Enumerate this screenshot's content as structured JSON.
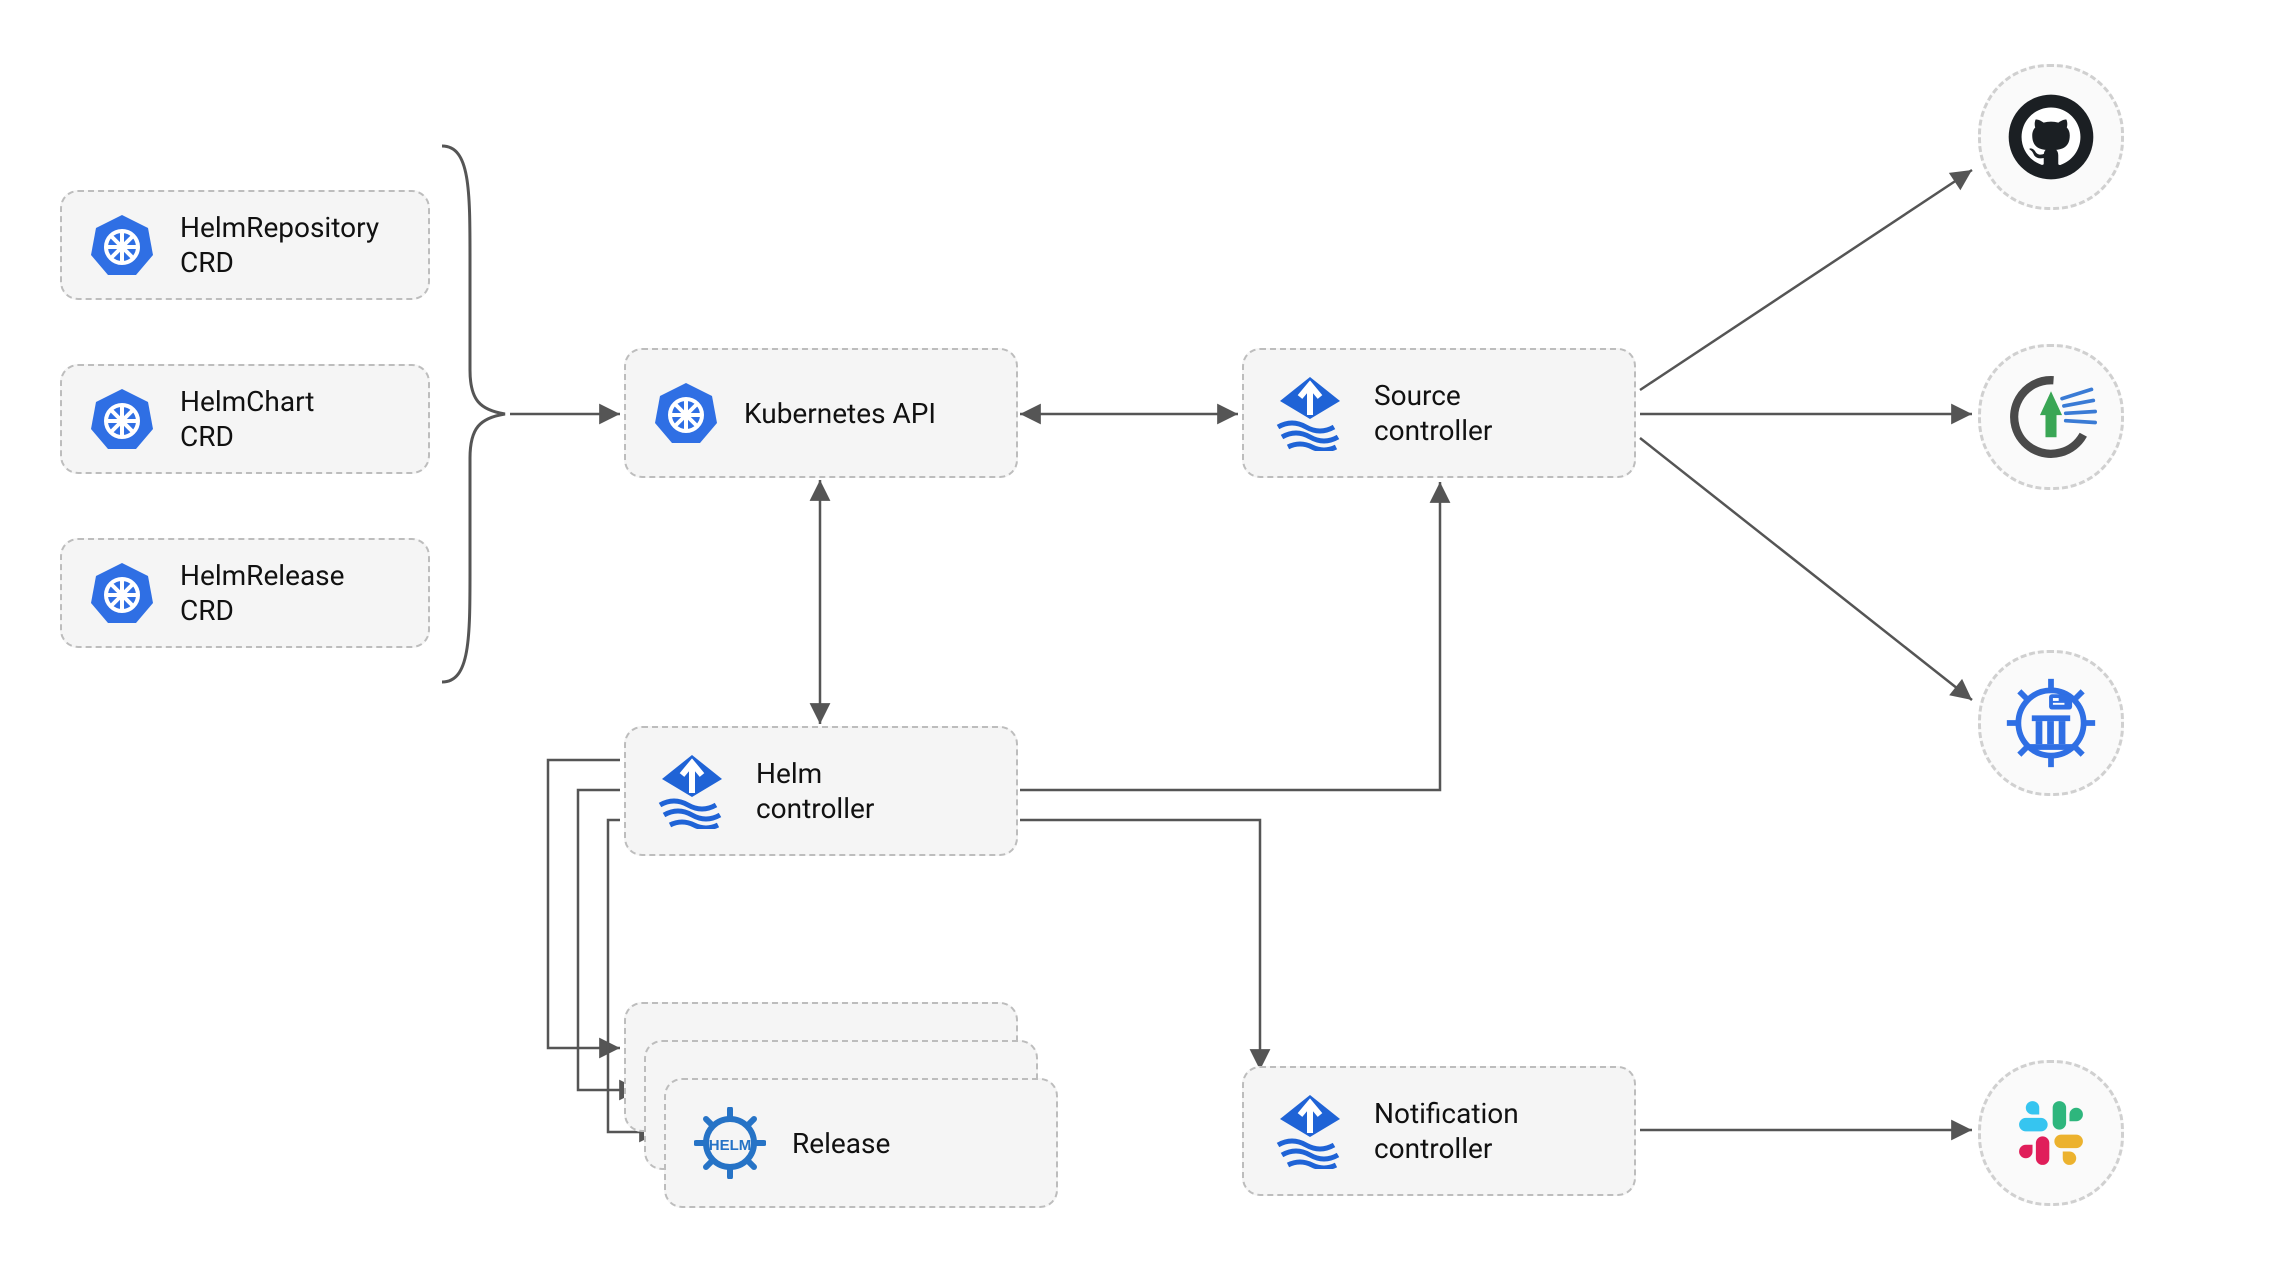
{
  "crds": {
    "helmRepository": "HelmRepository\nCRD",
    "helmChart": "HelmChart\nCRD",
    "helmRelease": "HelmRelease\nCRD"
  },
  "core": {
    "k8sApi": "Kubernetes API",
    "sourceController": "Source\ncontroller",
    "helmController": "Helm\ncontroller",
    "release": "Release",
    "notificationController": "Notification\ncontroller"
  },
  "externals": {
    "github": "GitHub",
    "harbor": "Harbor",
    "chartmuseum": "ChartMuseum",
    "slack": "Slack"
  },
  "edges": [
    [
      "crd-group",
      "k8s-api",
      "forward"
    ],
    [
      "k8s-api",
      "source-controller",
      "both"
    ],
    [
      "k8s-api",
      "helm-controller",
      "both"
    ],
    [
      "helm-controller",
      "source-controller",
      "forward"
    ],
    [
      "helm-controller",
      "notification-controller",
      "forward"
    ],
    [
      "helm-controller",
      "release",
      "forward-multi"
    ],
    [
      "source-controller",
      "github",
      "forward"
    ],
    [
      "source-controller",
      "harbor",
      "forward"
    ],
    [
      "source-controller",
      "chartmuseum",
      "forward"
    ],
    [
      "notification-controller",
      "slack",
      "forward"
    ]
  ]
}
